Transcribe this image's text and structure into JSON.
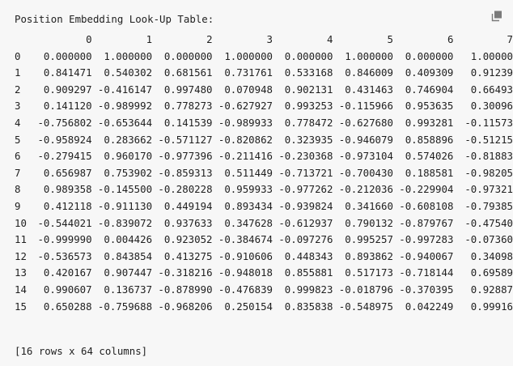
{
  "title": "Position Embedding Look-Up Table:",
  "columns": [
    "0",
    "1",
    "2",
    "3",
    "4",
    "5",
    "6",
    "7"
  ],
  "rows": [
    {
      "index": "0",
      "values": [
        "0.000000",
        "1.000000",
        "0.000000",
        "1.000000",
        "0.000000",
        "1.000000",
        "0.000000",
        "1.00000"
      ]
    },
    {
      "index": "1",
      "values": [
        "0.841471",
        "0.540302",
        "0.681561",
        "0.731761",
        "0.533168",
        "0.846009",
        "0.409309",
        "0.91239"
      ]
    },
    {
      "index": "2",
      "values": [
        "0.909297",
        "-0.416147",
        "0.997480",
        "0.070948",
        "0.902131",
        "0.431463",
        "0.746904",
        "0.66493"
      ]
    },
    {
      "index": "3",
      "values": [
        "0.141120",
        "-0.989992",
        "0.778273",
        "-0.627927",
        "0.993253",
        "-0.115966",
        "0.953635",
        "0.30096"
      ]
    },
    {
      "index": "4",
      "values": [
        "-0.756802",
        "-0.653644",
        "0.141539",
        "-0.989933",
        "0.778472",
        "-0.627680",
        "0.993281",
        "-0.11573"
      ]
    },
    {
      "index": "5",
      "values": [
        "-0.958924",
        "0.283662",
        "-0.571127",
        "-0.820862",
        "0.323935",
        "-0.946079",
        "0.858896",
        "-0.51215"
      ]
    },
    {
      "index": "6",
      "values": [
        "-0.279415",
        "0.960170",
        "-0.977396",
        "-0.211416",
        "-0.230368",
        "-0.973104",
        "0.574026",
        "-0.81883"
      ]
    },
    {
      "index": "7",
      "values": [
        "0.656987",
        "0.753902",
        "-0.859313",
        "0.511449",
        "-0.713721",
        "-0.700430",
        "0.188581",
        "-0.98205"
      ]
    },
    {
      "index": "8",
      "values": [
        "0.989358",
        "-0.145500",
        "-0.280228",
        "0.959933",
        "-0.977262",
        "-0.212036",
        "-0.229904",
        "-0.97321"
      ]
    },
    {
      "index": "9",
      "values": [
        "0.412118",
        "-0.911130",
        "0.449194",
        "0.893434",
        "-0.939824",
        "0.341660",
        "-0.608108",
        "-0.79385"
      ]
    },
    {
      "index": "10",
      "values": [
        "-0.544021",
        "-0.839072",
        "0.937633",
        "0.347628",
        "-0.612937",
        "0.790132",
        "-0.879767",
        "-0.47540"
      ]
    },
    {
      "index": "11",
      "values": [
        "-0.999990",
        "0.004426",
        "0.923052",
        "-0.384674",
        "-0.097276",
        "0.995257",
        "-0.997283",
        "-0.07360"
      ]
    },
    {
      "index": "12",
      "values": [
        "-0.536573",
        "0.843854",
        "0.413275",
        "-0.910606",
        "0.448343",
        "0.893862",
        "-0.940067",
        "0.34098"
      ]
    },
    {
      "index": "13",
      "values": [
        "0.420167",
        "0.907447",
        "-0.318216",
        "-0.948018",
        "0.855881",
        "0.517173",
        "-0.718144",
        "0.69589"
      ]
    },
    {
      "index": "14",
      "values": [
        "0.990607",
        "0.136737",
        "-0.878990",
        "-0.476839",
        "0.999823",
        "-0.018796",
        "-0.370395",
        "0.92887"
      ]
    },
    {
      "index": "15",
      "values": [
        "0.650288",
        "-0.759688",
        "-0.968206",
        "0.250154",
        "0.835838",
        "-0.548975",
        "0.042249",
        "0.99916"
      ]
    }
  ],
  "footer": "[16 rows x 64 columns]",
  "icons": {
    "copy": "copy-icon"
  }
}
